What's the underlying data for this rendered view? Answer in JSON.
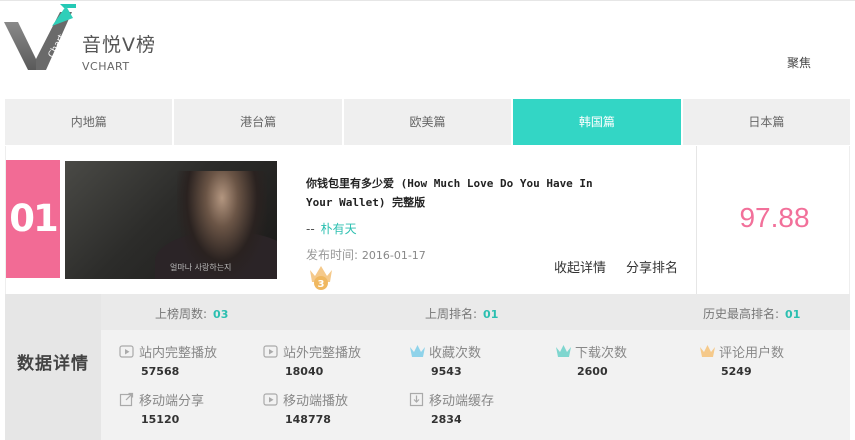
{
  "brand": {
    "title": "音悦V榜",
    "subtitle": "VCHART",
    "logo_text": "Chart"
  },
  "header": {
    "focus_label": "聚焦"
  },
  "tabs": [
    {
      "label": "内地篇",
      "active": false
    },
    {
      "label": "港台篇",
      "active": false
    },
    {
      "label": "欧美篇",
      "active": false
    },
    {
      "label": "韩国篇",
      "active": true
    },
    {
      "label": "日本篇",
      "active": false
    }
  ],
  "entry": {
    "rank": "01",
    "title": "你钱包里有多少爱 (How Much Love Do You Have In Your Wallet) 完整版",
    "artist_prefix": "--",
    "artist": "朴有天",
    "release_label": "发布时间:",
    "release_date": "2016-01-17",
    "crown_badge": "3",
    "thumb_caption": "얼마나 사랑하는지",
    "collapse_label": "收起详情",
    "share_label": "分享排名",
    "score": "97.88"
  },
  "stats": {
    "section_title": "数据详情",
    "top": [
      {
        "label": "上榜周数:",
        "value": "03"
      },
      {
        "label": "上周排名:",
        "value": "01"
      },
      {
        "label": "历史最高排名:",
        "value": "01"
      }
    ],
    "metrics": [
      {
        "label": "站内完整播放",
        "value": "57568",
        "icon": "play-icon"
      },
      {
        "label": "站外完整播放",
        "value": "18040",
        "icon": "play-icon"
      },
      {
        "label": "收藏次数",
        "value": "9543",
        "icon": "crown-icon"
      },
      {
        "label": "下载次数",
        "value": "2600",
        "icon": "crown-icon"
      },
      {
        "label": "评论用户数",
        "value": "5249",
        "icon": "crown-icon"
      },
      {
        "label": "移动端分享",
        "value": "15120",
        "icon": "share-icon"
      },
      {
        "label": "移动端播放",
        "value": "148778",
        "icon": "play-icon"
      },
      {
        "label": "移动端缓存",
        "value": "2834",
        "icon": "download-icon"
      }
    ]
  },
  "colors": {
    "accent": "#33d6c5",
    "rank_pink": "#f26b95",
    "score_pink": "#f2709a",
    "crown_blue": "#8fd3ea",
    "crown_teal": "#7fd6cf",
    "crown_orange": "#f5c98a"
  }
}
